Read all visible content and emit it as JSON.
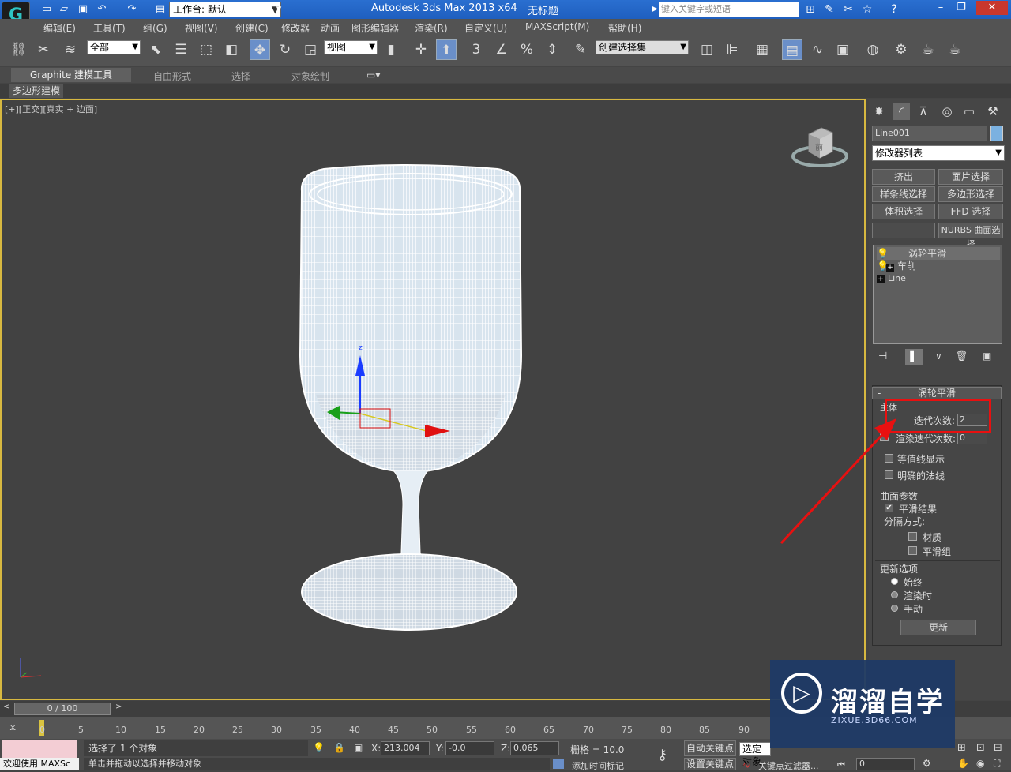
{
  "titlebar": {
    "workspace": "工作台: 默认",
    "app_title": "Autodesk 3ds Max  2013 x64",
    "doc_title": "无标题",
    "search_placeholder": "键入关键字或短语"
  },
  "menu": [
    "编辑(E)",
    "工具(T)",
    "组(G)",
    "视图(V)",
    "创建(C)",
    "修改器",
    "动画",
    "图形编辑器",
    "渲染(R)",
    "自定义(U)",
    "MAXScript(M)",
    "帮助(H)"
  ],
  "toolbar": {
    "filter": "全部",
    "refcoord": "视图",
    "selset": "创建选择集"
  },
  "ribbon": {
    "tabs": [
      "Graphite 建模工具",
      "自由形式",
      "选择",
      "对象绘制"
    ],
    "sub": "多边形建模"
  },
  "viewport": {
    "label": "[+][正交][真实 + 边面]",
    "navcube_face": "前"
  },
  "panel": {
    "object_name": "Line001",
    "modifier_list": "修改器列表",
    "buttons": [
      "挤出",
      "面片选择",
      "样条线选择",
      "多边形选择",
      "体积选择",
      "FFD 选择",
      "",
      "NURBS 曲面选择"
    ],
    "stack": [
      {
        "label": "涡轮平滑"
      },
      {
        "label": "车削"
      },
      {
        "label": "Line"
      }
    ],
    "rollout_title": "涡轮平滑",
    "main_group": "主体",
    "iterations_label": "迭代次数:",
    "iterations_value": "2",
    "render_iters_label": "渲染迭代次数:",
    "render_iters_value": "0",
    "isoline": "等值线显示",
    "explicit_normals": "明确的法线",
    "surface_group": "曲面参数",
    "smooth_result": "平滑结果",
    "separate_by": "分隔方式:",
    "material": "材质",
    "smoothing_groups": "平滑组",
    "update_group": "更新选项",
    "always": "始终",
    "when_rendering": "渲染时",
    "manually": "手动",
    "update_button": "更新"
  },
  "timeline": {
    "slider": "0 / 100",
    "ticks": [
      "0",
      "5",
      "10",
      "15",
      "20",
      "25",
      "30",
      "35",
      "40",
      "45",
      "50",
      "55",
      "60",
      "65",
      "70",
      "75",
      "80",
      "85",
      "90"
    ]
  },
  "status": {
    "welcome": "欢迎使用 MAXSc",
    "selected": "选择了 1 个对象",
    "hint": "单击并拖动以选择并移动对象",
    "x_label": "X:",
    "x": "213.004",
    "y_label": "Y:",
    "y": "-0.0",
    "z_label": "Z:",
    "z": "0.065",
    "grid": "栅格 = 10.0",
    "add_time_tag": "添加时间标记",
    "auto_key": "自动关键点",
    "selected_obj": "选定对象",
    "set_key": "设置关键点",
    "key_filters": "关键点过滤器...",
    "frame": "0"
  },
  "watermark": {
    "title": "溜溜自学",
    "url": "ZIXUE.3D66.COM"
  }
}
